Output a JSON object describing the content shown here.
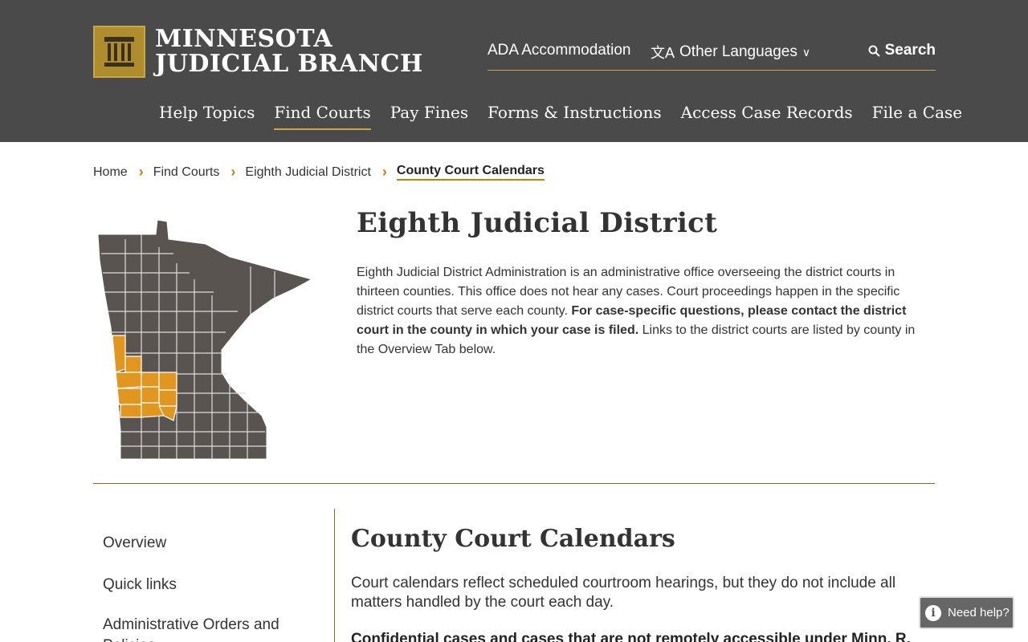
{
  "header": {
    "logo_line1": "MINNESOTA",
    "logo_line2": "JUDICIAL BRANCH",
    "ada": "ADA Accommodation",
    "languages": "Other Languages",
    "search": "Search",
    "nav": [
      "Help Topics",
      "Find Courts",
      "Pay Fines",
      "Forms & Instructions",
      "Access Case Records",
      "File a Case"
    ],
    "active_nav": "Find Courts"
  },
  "breadcrumb": {
    "items": [
      "Home",
      "Find Courts",
      "Eighth Judicial District"
    ],
    "current": "County Court Calendars"
  },
  "district": {
    "title": "Eighth Judicial District",
    "text_1": "Eighth Judicial District Administration is an administrative office overseeing the district courts in thirteen counties. This office does not hear any cases. Court proceedings happen in the specific district courts that serve each county. ",
    "text_bold": "For case-specific questions, please contact the district court in the county in which your case is filed.",
    "text_2": " Links to the district courts are listed by county in the Overview Tab below."
  },
  "sidenav": {
    "items": [
      "Overview",
      "Quick links",
      "Administrative Orders and Policies"
    ]
  },
  "main": {
    "title": "County Court Calendars",
    "text": "Court calendars reflect scheduled courtroom hearings, but they do not include all matters handled by the court each day.",
    "bold_text": "Confidential cases and cases that are not remotely accessible under Minn. R."
  },
  "help": {
    "label": "Need help?"
  },
  "colors": {
    "header_bg": "#4a4a4a",
    "accent_gold": "#b8860b",
    "map_gray": "#5a5450",
    "map_highlight": "#e0961f"
  }
}
